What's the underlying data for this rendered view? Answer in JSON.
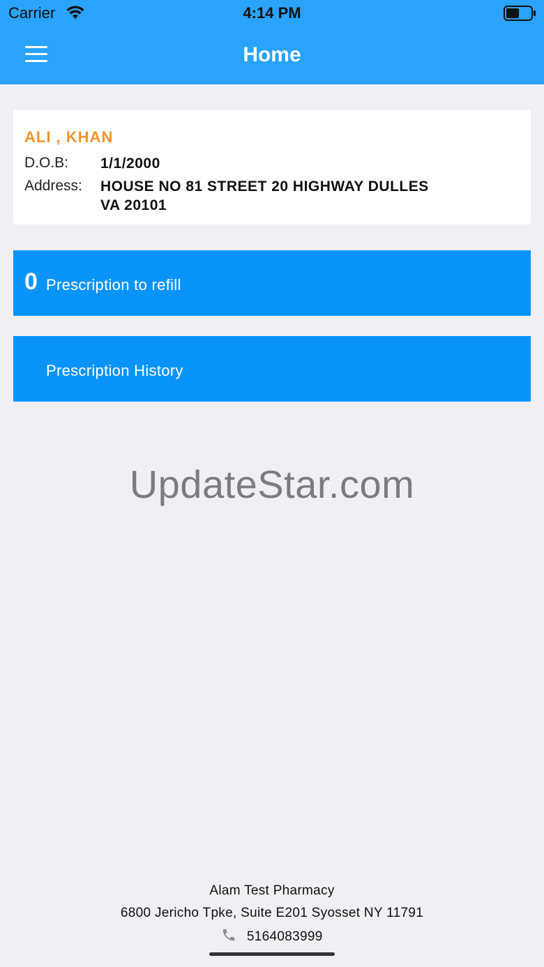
{
  "status_bar": {
    "carrier": "Carrier",
    "time": "4:14 PM",
    "icons": [
      "wifi-icon",
      "battery-icon"
    ]
  },
  "navbar": {
    "title": "Home",
    "menu_icon": "hamburger-menu-icon"
  },
  "patient": {
    "name": "ALI , KHAN",
    "dob_label": "D.O.B:",
    "dob": "1/1/2000",
    "address_label": "Address:",
    "address_line1": "HOUSE NO 81 STREET 20 HIGHWAY DULLES",
    "address_line2": "VA 20101"
  },
  "refill": {
    "count": "0",
    "label": "Prescription to refill"
  },
  "history": {
    "label": "Prescription History"
  },
  "watermark": "UpdateStar.com",
  "pharmacy": {
    "name": "Alam Test Pharmacy",
    "address": "6800 Jericho Tpke, Suite E201 Syosset NY 11791",
    "phone": "5164083999",
    "phone_icon": "phone-icon"
  },
  "colors": {
    "navbar": "#29a3fb",
    "button": "#0994fb",
    "name_accent": "#f0952a",
    "background": "#efeff4"
  }
}
